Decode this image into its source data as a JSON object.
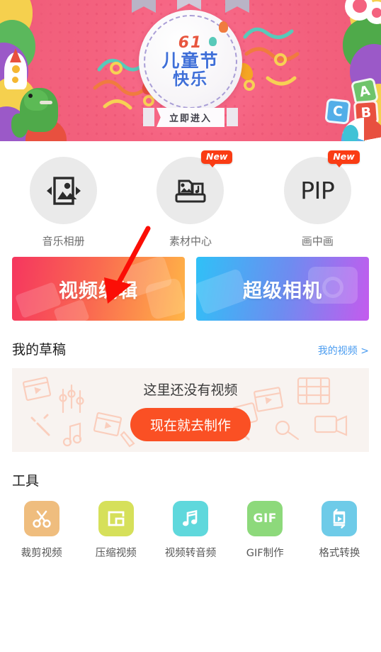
{
  "banner": {
    "festival_number": "61",
    "title_line1": "儿童节",
    "title_line2": "快乐",
    "cta_label": "立即进入",
    "bg_color": "#f4627f"
  },
  "quick_icons": [
    {
      "label": "音乐相册",
      "icon": "photo-frame-icon",
      "badge": ""
    },
    {
      "label": "素材中心",
      "icon": "material-stand-icon",
      "badge": "New"
    },
    {
      "label": "画中画",
      "icon": "pip-text-icon",
      "badge": "New",
      "glyph": "PIP"
    }
  ],
  "primary_actions": [
    {
      "label": "视频编辑",
      "gradient_from": "#f5365f",
      "gradient_to": "#ffb547"
    },
    {
      "label": "超级相机",
      "gradient_from": "#2fc1f7",
      "gradient_to": "#c45bee"
    }
  ],
  "drafts": {
    "section_title": "我的草稿",
    "link_label": "我的视频 >",
    "link_color": "#4a9cf0",
    "empty_text": "这里还没有视频",
    "empty_button": "现在就去制作",
    "button_color": "#fa5024"
  },
  "tools": {
    "section_title": "工具",
    "items": [
      {
        "label": "裁剪视频",
        "icon": "scissors-icon",
        "color": "#efbd7e"
      },
      {
        "label": "压缩视频",
        "icon": "compress-frame-icon",
        "color": "#d6e05a"
      },
      {
        "label": "视频转音频",
        "icon": "music-notes-icon",
        "color": "#5fd8dc"
      },
      {
        "label": "GIF制作",
        "icon": "gif-text-icon",
        "color": "#8dd97b",
        "glyph": "GIF"
      },
      {
        "label": "格式转换",
        "icon": "convert-loop-icon",
        "color": "#6ecbe8"
      }
    ]
  },
  "annotation": {
    "arrow_color": "#fb0e06",
    "points_at": "视频编辑"
  }
}
